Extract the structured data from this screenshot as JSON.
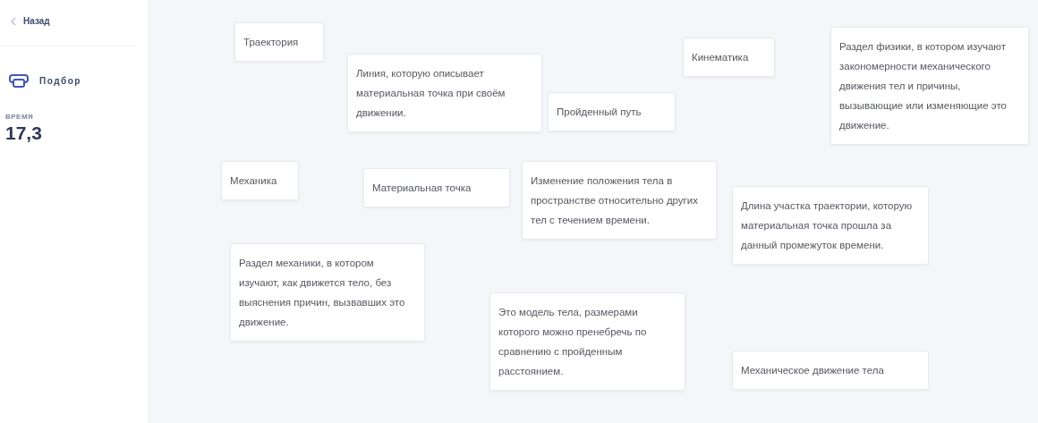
{
  "sidebar": {
    "back": "Назад",
    "mode": "Подбор",
    "timer_label": "ВРЕМЯ",
    "timer_value": "17,3"
  },
  "cards": [
    {
      "text": "Траектория"
    },
    {
      "text": "Линия, которую описывает материальная точка при своём движении."
    },
    {
      "text": "Кинематика"
    },
    {
      "text": "Раздел физики, в котором изучают закономерности механического движения тел и причины, вызывающие или изменяющие это движение."
    },
    {
      "text": "Пройденный путь"
    },
    {
      "text": "Механика"
    },
    {
      "text": "Материальная точка"
    },
    {
      "text": "Изменение положения тела в пространстве относительно других тел с течением времени."
    },
    {
      "text": "Длина участка траектории, которую материальная точка прошла за данный промежуток времени."
    },
    {
      "text": "Раздел механики, в котором изучают, как движется тело, без выяснения причин, вызвавших это движение."
    },
    {
      "text": "Это модель тела, размерами которого можно пренебречь по сравнению с пройденным расстоянием."
    },
    {
      "text": "Механическое движение тела"
    }
  ]
}
